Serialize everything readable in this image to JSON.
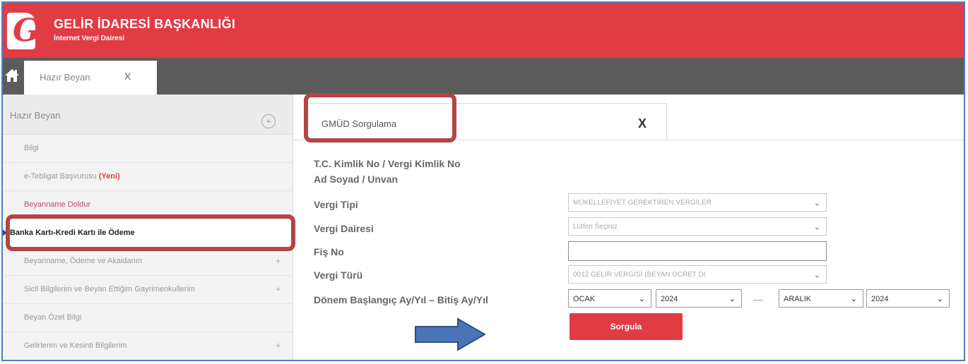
{
  "header": {
    "title": "GELİR İDARESİ BAŞKANLIĞI",
    "subtitle": "İnternet Vergi Dairesi",
    "logo_letter": "G",
    "background": "#e13b44"
  },
  "tabbar": {
    "home_icon": "home-icon",
    "tab_label": "Hazır Beyan",
    "tab_close": "X"
  },
  "sidebar": {
    "header_label": "Hazır Beyan",
    "header_toggle": "+",
    "items": [
      {
        "label": "Bilgi",
        "plus": ""
      },
      {
        "label": "e-Tebligat Başvurusu",
        "tag": "(Yeni)",
        "plus": ""
      },
      {
        "label": "Beyanname Doldur",
        "plus": ""
      },
      {
        "label": "Banka Kartı-Kredi Kartı ile Ödeme",
        "plus": ""
      },
      {
        "label": "Beyanname, Ödeme ve Akaidanın",
        "plus": "+"
      },
      {
        "label": "Sicil Bilgilerim ve Beyan Ettiğim Gayrimenkullerim",
        "plus": "+"
      },
      {
        "label": "Beyan Özet Bilgi",
        "plus": ""
      },
      {
        "label": "Gelirlerim ve Kesinti Bilgilerim",
        "plus": "+"
      }
    ]
  },
  "content": {
    "tab_label": "GMÜD Sorgulama",
    "tab_close": "X",
    "form": {
      "id_label": "T.C. Kimlik No / Vergi Kimlik No",
      "name_label": "Ad Soyad / Unvan",
      "tax_type_label": "Vergi Tipi",
      "tax_type_value": "MÜKELLEFİYET GEREKTİREN VERGİLER",
      "tax_office_label": "Vergi Dairesi",
      "tax_office_value": "Lütfen Seçiniz",
      "slip_label": "Fiş No",
      "slip_value": "",
      "tax_kind_label": "Vergi Türü",
      "tax_kind_value": "0012 GELİR VERGİSİ (BEYAN ÜCRET DI",
      "period_label": "Dönem Başlangıç Ay/Yıl – Bitiş Ay/Yıl",
      "start_month": "OCAK",
      "start_year": "2024",
      "separator": "—",
      "end_month": "ARALIK",
      "end_year": "2024",
      "submit_label": "Sorgula"
    }
  },
  "colors": {
    "brand_red": "#e13b44",
    "highlight": "#b34543",
    "arrow_blue": "#4a76b8"
  }
}
